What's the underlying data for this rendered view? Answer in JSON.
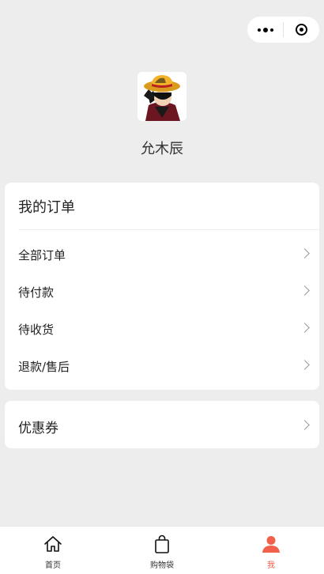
{
  "colors": {
    "accent": "#f0604a",
    "background": "#ededed"
  },
  "capsule": {
    "menu_icon": "more-icon",
    "close_icon": "target-icon"
  },
  "profile": {
    "name": "允木辰",
    "avatar_icon": "anime-avatar"
  },
  "orders": {
    "title": "我的订单",
    "items": [
      {
        "label": "全部订单"
      },
      {
        "label": "待付款"
      },
      {
        "label": "待收货"
      },
      {
        "label": "退款/售后"
      }
    ]
  },
  "coupon": {
    "label": "优惠券"
  },
  "tabbar": {
    "tabs": [
      {
        "label": "首页",
        "icon": "home-icon",
        "active": false
      },
      {
        "label": "购物袋",
        "icon": "bag-icon",
        "active": false
      },
      {
        "label": "我",
        "icon": "person-icon",
        "active": true
      }
    ]
  }
}
